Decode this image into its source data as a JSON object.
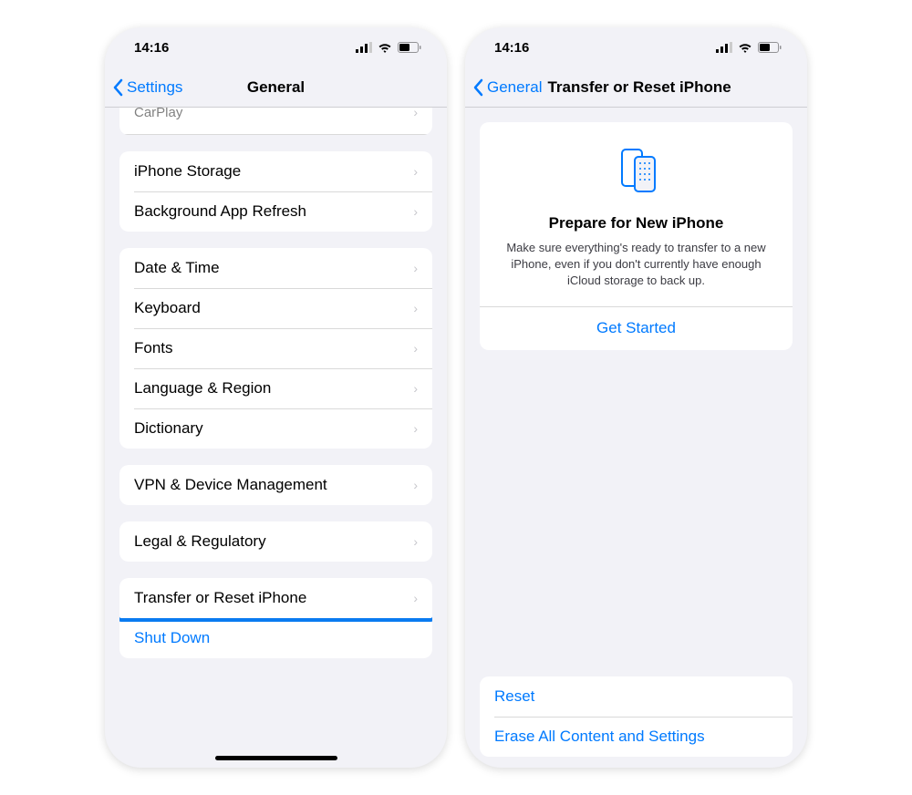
{
  "status": {
    "time": "14:16"
  },
  "left": {
    "back": "Settings",
    "title": "General",
    "partialRow": "CarPlay",
    "group1": [
      "iPhone Storage",
      "Background App Refresh"
    ],
    "group2": [
      "Date & Time",
      "Keyboard",
      "Fonts",
      "Language & Region",
      "Dictionary"
    ],
    "group3": [
      "VPN & Device Management"
    ],
    "group4": [
      "Legal & Regulatory"
    ],
    "group5": {
      "transfer": "Transfer or Reset iPhone",
      "shutdown": "Shut Down"
    }
  },
  "right": {
    "back": "General",
    "title": "Transfer or Reset iPhone",
    "prepare": {
      "heading": "Prepare for New iPhone",
      "description": "Make sure everything's ready to transfer to a new iPhone, even if you don't currently have enough iCloud storage to back up.",
      "cta": "Get Started"
    },
    "bottom": {
      "reset": "Reset",
      "erase": "Erase All Content and Settings"
    }
  }
}
